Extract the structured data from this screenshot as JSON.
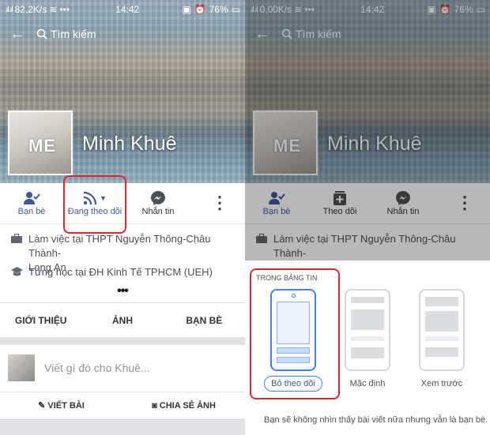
{
  "status_left": {
    "speed": "82,2K/s",
    "time": "14:42",
    "battery": "76%"
  },
  "status_right": {
    "speed": "0,00K/s",
    "time": "14:42",
    "battery": "76%"
  },
  "search": {
    "placeholder": "Tìm kiếm"
  },
  "profile": {
    "name": "Minh Khuê",
    "photo_text": "ME"
  },
  "actions_left": {
    "friends": "Bạn bè",
    "following": "Đang theo dõi",
    "message": "Nhắn tin"
  },
  "actions_right": {
    "friends": "Bạn bè",
    "follow": "Theo dõi",
    "message": "Nhắn tin"
  },
  "info": {
    "work_line1": "Làm việc tại THPT Nguyễn Thông-Châu Thành-",
    "work_line2": "Long An",
    "study": "Từng học tại ĐH Kinh Tế TPHCM (UEH)",
    "more": "•••"
  },
  "tabs": {
    "about": "GIỚI THIỆU",
    "photos": "ẢNH",
    "friends": "BẠN BÈ"
  },
  "composer": {
    "placeholder": "Viết gì đó cho Khuê..."
  },
  "post_actions": {
    "write": "VIẾT BÀI",
    "share_photo": "CHIA SẺ ẢNH"
  },
  "sheet": {
    "title": "TRONG BẢNG TIN",
    "options": [
      "Bỏ theo dõi",
      "Mặc định",
      "Xem trước"
    ],
    "selected": "Bỏ theo dõi",
    "description": "Bạn sẽ không nhìn thấy bài viết nữa nhưng vẫn là bạn bè."
  },
  "colors": {
    "fb_blue": "#3b5998",
    "highlight": "#e0242b",
    "select_blue": "#4080ff"
  },
  "icons": [
    "back-arrow-icon",
    "search-icon",
    "friends-check-icon",
    "rss-icon",
    "messenger-icon",
    "more-vert-icon",
    "briefcase-icon",
    "graduation-cap-icon",
    "pencil-icon",
    "camera-icon",
    "follow-plus-icon"
  ]
}
